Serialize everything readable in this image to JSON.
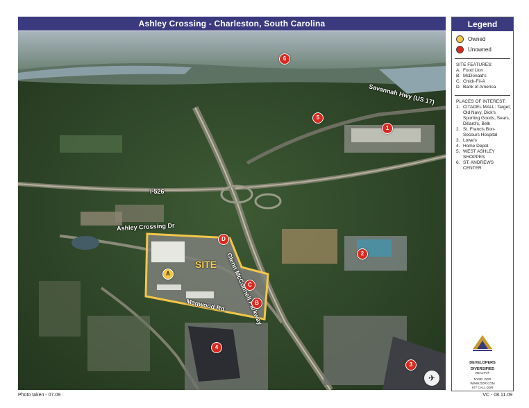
{
  "title": "Ashley Crossing - Charleston, South Carolina",
  "map": {
    "road_labels": {
      "savannah": "Savannah Hwy (US 17)",
      "i526": "I-526",
      "glenn": "Glenn McConnell Parkway",
      "ashley_crossing_dr": "Ashley Crossing Dr",
      "magwood": "Magwood Rd."
    },
    "site_label": "SITE",
    "markers": {
      "m1": "1",
      "m2": "2",
      "m3": "3",
      "m4": "4",
      "m5": "5",
      "m6": "6",
      "ma": "A",
      "mb": "B",
      "mc": "C",
      "md": "D"
    },
    "compass_symbol": "✈"
  },
  "legend": {
    "title": "Legend",
    "owned": "Owned",
    "unowned": "Unowned",
    "site_features_title": "SITE FEATURES:",
    "site_features": [
      {
        "key": "A.",
        "text": "Food Lion"
      },
      {
        "key": "B.",
        "text": "McDonald's"
      },
      {
        "key": "C.",
        "text": "Chick-Fil-A"
      },
      {
        "key": "D.",
        "text": "Bank of America"
      }
    ],
    "poi_title": "PLACES OF INTEREST:",
    "poi": [
      {
        "key": "1.",
        "text": "CITADEL MALL: Target, Old Navy, Dick's Sporting Goods, Sears, Dillard's, Belk"
      },
      {
        "key": "2.",
        "text": "St. Francis Bon-Secours Hospital"
      },
      {
        "key": "3.",
        "text": "Lowe's"
      },
      {
        "key": "4.",
        "text": "Home Depot"
      },
      {
        "key": "5.",
        "text": "WEST ASHLEY SHOPPES"
      },
      {
        "key": "6.",
        "text": "ST. ANDREWS CENTER"
      }
    ],
    "logo": {
      "name1": "DEVELOPERS",
      "name2": "DIVERSIFIED",
      "name3": "REALTY®",
      "line1": "NYSE: DDR",
      "line2": "WWW.DDR.COM",
      "line3": "877 CALL DDR"
    }
  },
  "footer": {
    "left": "Photo taken - 07.09",
    "right": "VC - 08.11.09"
  },
  "colors": {
    "header": "#3b3a7e",
    "owned": "#f3c64a",
    "unowned": "#d92a1f",
    "site_outline": "#f3c64a"
  }
}
